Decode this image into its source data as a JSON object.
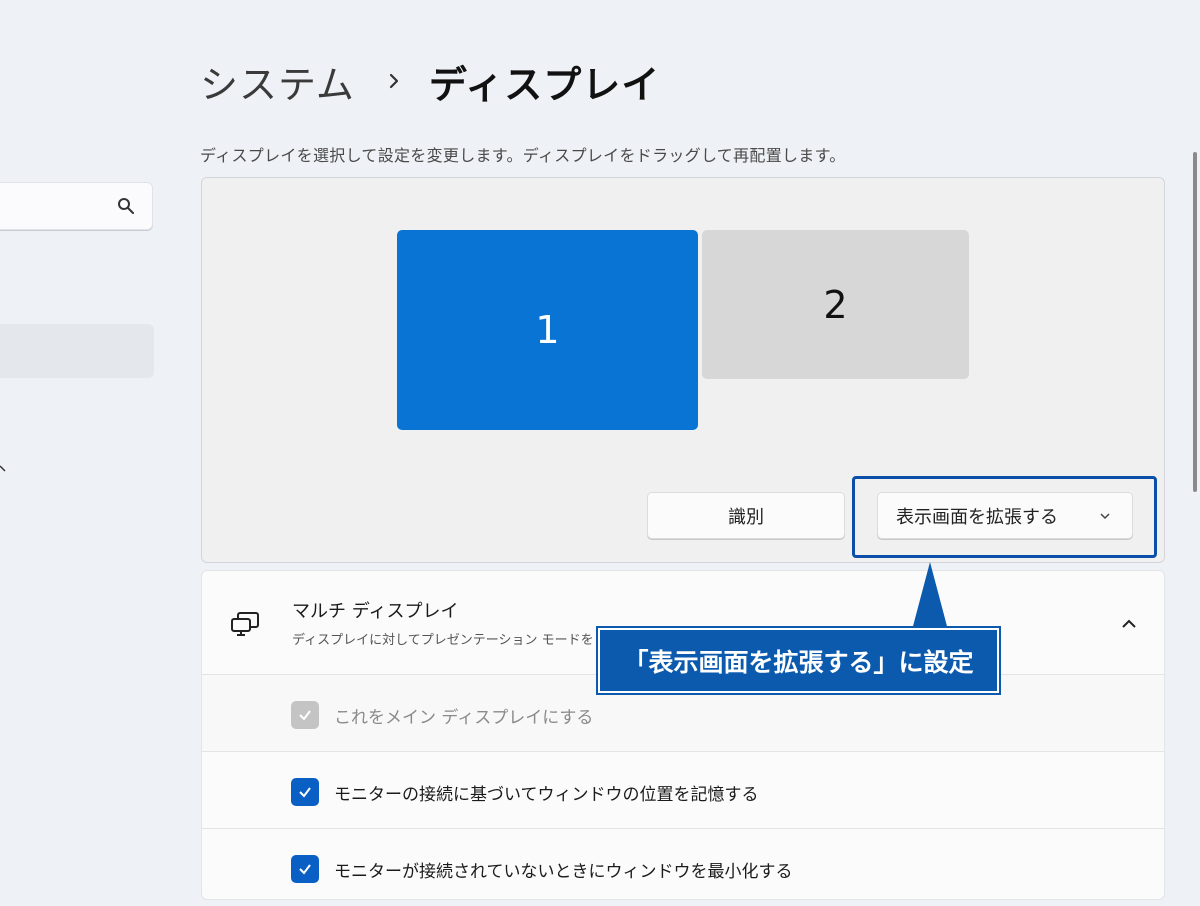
{
  "header": {
    "breadcrumb_parent": "システム",
    "breadcrumb_current": "ディスプレイ"
  },
  "description": "ディスプレイを選択して設定を変更します。ディスプレイをドラッグして再配置します。",
  "displays": [
    {
      "label": "1",
      "selected": true
    },
    {
      "label": "2",
      "selected": false
    }
  ],
  "actions": {
    "identify_label": "識別",
    "mode_value": "表示画面を拡張する"
  },
  "multi_display": {
    "title": "マルチ ディスプレイ",
    "subtitle": "ディスプレイに対してプレゼンテーション モードを"
  },
  "options": [
    {
      "label": "これをメイン ディスプレイにする",
      "checked": true,
      "disabled": true
    },
    {
      "label": "モニターの接続に基づいてウィンドウの位置を記憶する",
      "checked": true,
      "disabled": false
    },
    {
      "label": "モニターが接続されていないときにウィンドウを最小化する",
      "checked": true,
      "disabled": false
    }
  ],
  "callout": {
    "text": "「表示画面を拡張する」に設定"
  },
  "colors": {
    "accent": "#0a74d4",
    "callout": "#0b5aad",
    "checkbox": "#0a5fc4"
  }
}
